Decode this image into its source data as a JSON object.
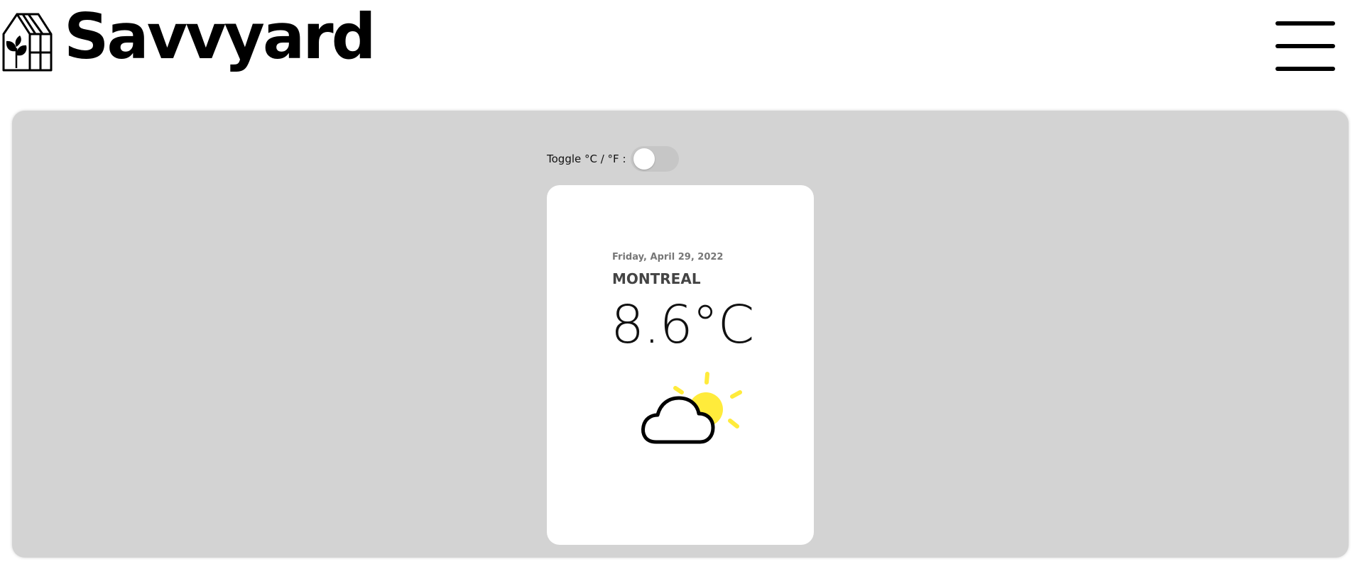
{
  "header": {
    "brand": "Savvyard",
    "logo_icon": "greenhouse-leaf-icon",
    "menu_icon": "hamburger-menu-icon"
  },
  "toggle": {
    "label": "Toggle °C / °F :",
    "unit_state": "celsius"
  },
  "weather": {
    "date": "Friday, April 29, 2022",
    "city": "MONTREAL",
    "temperature": "8.6°C",
    "condition_icon": "partly-cloudy-icon"
  },
  "colors": {
    "panel_background": "#d3d3d3",
    "card_background": "#ffffff",
    "sun": "#ffeb3b"
  }
}
